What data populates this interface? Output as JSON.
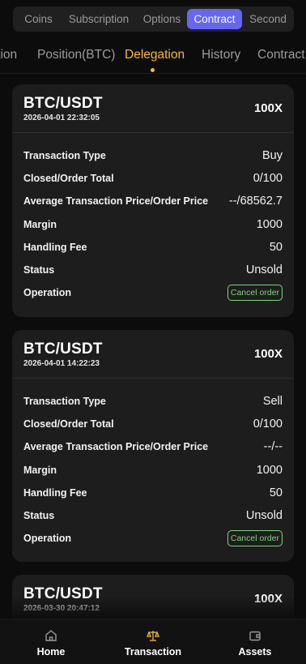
{
  "top_tabs": [
    "Coins",
    "Subscription",
    "Options",
    "Contract",
    "Second"
  ],
  "sub_tabs": [
    "Position",
    "Position(BTC)",
    "Delegation",
    "History",
    "Contract"
  ],
  "cards": [
    {
      "pair": "BTC/USDT",
      "time": "2026-04-01 22:32:05",
      "leverage": "100X",
      "rows": [
        {
          "label": "Transaction Type",
          "value": "Buy"
        },
        {
          "label": "Closed/Order Total",
          "value": "0/100"
        },
        {
          "label": "Average Transaction Price/Order Price",
          "value": "--/68562.7"
        },
        {
          "label": "Margin",
          "value": "1000"
        },
        {
          "label": "Handling Fee",
          "value": "50"
        },
        {
          "label": "Status",
          "value": "Unsold"
        }
      ],
      "operation_label": "Operation",
      "button": "Cancel order"
    },
    {
      "pair": "BTC/USDT",
      "time": "2026-04-01 14:22:23",
      "leverage": "100X",
      "rows": [
        {
          "label": "Transaction Type",
          "value": "Sell"
        },
        {
          "label": "Closed/Order Total",
          "value": "0/100"
        },
        {
          "label": "Average Transaction Price/Order Price",
          "value": "--/--"
        },
        {
          "label": "Margin",
          "value": "1000"
        },
        {
          "label": "Handling Fee",
          "value": "50"
        },
        {
          "label": "Status",
          "value": "Unsold"
        }
      ],
      "operation_label": "Operation",
      "button": "Cancel order"
    },
    {
      "pair": "BTC/USDT",
      "time": "2026-03-30 20:47:12",
      "leverage": "100X"
    }
  ],
  "bottom_nav": [
    {
      "label": "Home",
      "icon": "home-icon"
    },
    {
      "label": "Transaction",
      "icon": "scale-icon"
    },
    {
      "label": "Assets",
      "icon": "wallet-icon"
    }
  ],
  "colors": {
    "accent": "#6567f0",
    "tab_active": "#f5b83a",
    "cancel": "#7cd47c"
  }
}
